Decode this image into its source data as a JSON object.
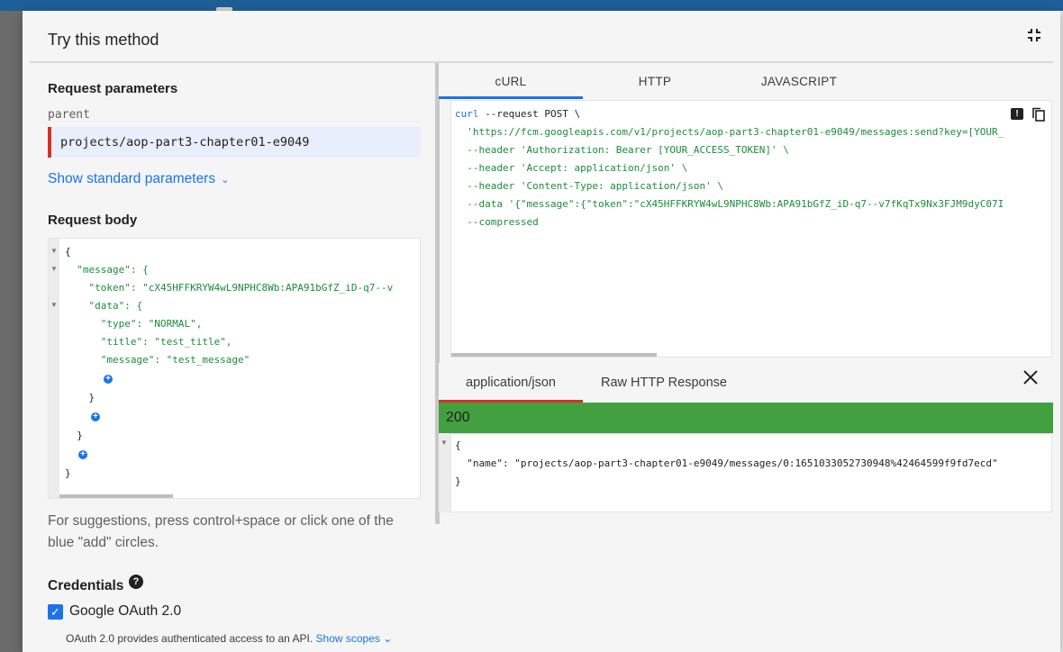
{
  "dialog": {
    "title": "Try this method"
  },
  "request_parameters": {
    "heading": "Request parameters",
    "param_name": "parent",
    "param_value": "projects/aop-part3-chapter01-e9049",
    "show_standard": "Show standard parameters"
  },
  "request_body": {
    "heading": "Request body",
    "lines": [
      "{",
      "  \"message\": {",
      "    \"token\": \"cX45HFFKRYW4wL9NPHC8Wb:APA91bGfZ_iD-q7--v",
      "    \"data\": {",
      "      \"type\": \"NORMAL\",",
      "      \"title\": \"test_title\",",
      "      \"message\": \"test_message\"",
      "    }",
      "  }",
      "}"
    ],
    "hint": "For suggestions, press control+space or click one of the blue \"add\" circles."
  },
  "credentials": {
    "heading": "Credentials",
    "oauth_label": "Google OAuth 2.0",
    "oauth_checked": true,
    "oauth_desc": "OAuth 2.0 provides authenticated access to an API.",
    "show_scopes": "Show scopes"
  },
  "code_tabs": [
    "cURL",
    "HTTP",
    "JAVASCRIPT"
  ],
  "curl_lines": [
    {
      "kw": "curl",
      "rest": " --request POST \\"
    },
    {
      "kw": "",
      "rest": "  'https://fcm.googleapis.com/v1/projects/aop-part3-chapter01-e9049/messages:send?key=[YOUR_"
    },
    {
      "kw": "",
      "rest": "  --header 'Authorization: Bearer [YOUR_ACCESS_TOKEN]' \\"
    },
    {
      "kw": "",
      "rest": "  --header 'Accept: application/json' \\"
    },
    {
      "kw": "",
      "rest": "  --header 'Content-Type: application/json' \\"
    },
    {
      "kw": "",
      "rest": "  --data '{\"message\":{\"token\":\"cX45HFFKRYW4wL9NPHC8Wb:APA91bGfZ_iD-q7--v7fKqTx9Nx3FJM9dyC07I"
    },
    {
      "kw": "",
      "rest": "  --compressed"
    }
  ],
  "response": {
    "tabs": [
      "application/json",
      "Raw HTTP Response"
    ],
    "status": "200",
    "lines": [
      "{",
      "  \"name\": \"projects/aop-part3-chapter01-e9049/messages/0:1651033052730948%42464599f9fd7ecd\"",
      "}"
    ]
  },
  "colors": {
    "accent": "#1a73e8",
    "success": "#43a040",
    "error": "#d93025",
    "string": "#1a8d3a"
  }
}
